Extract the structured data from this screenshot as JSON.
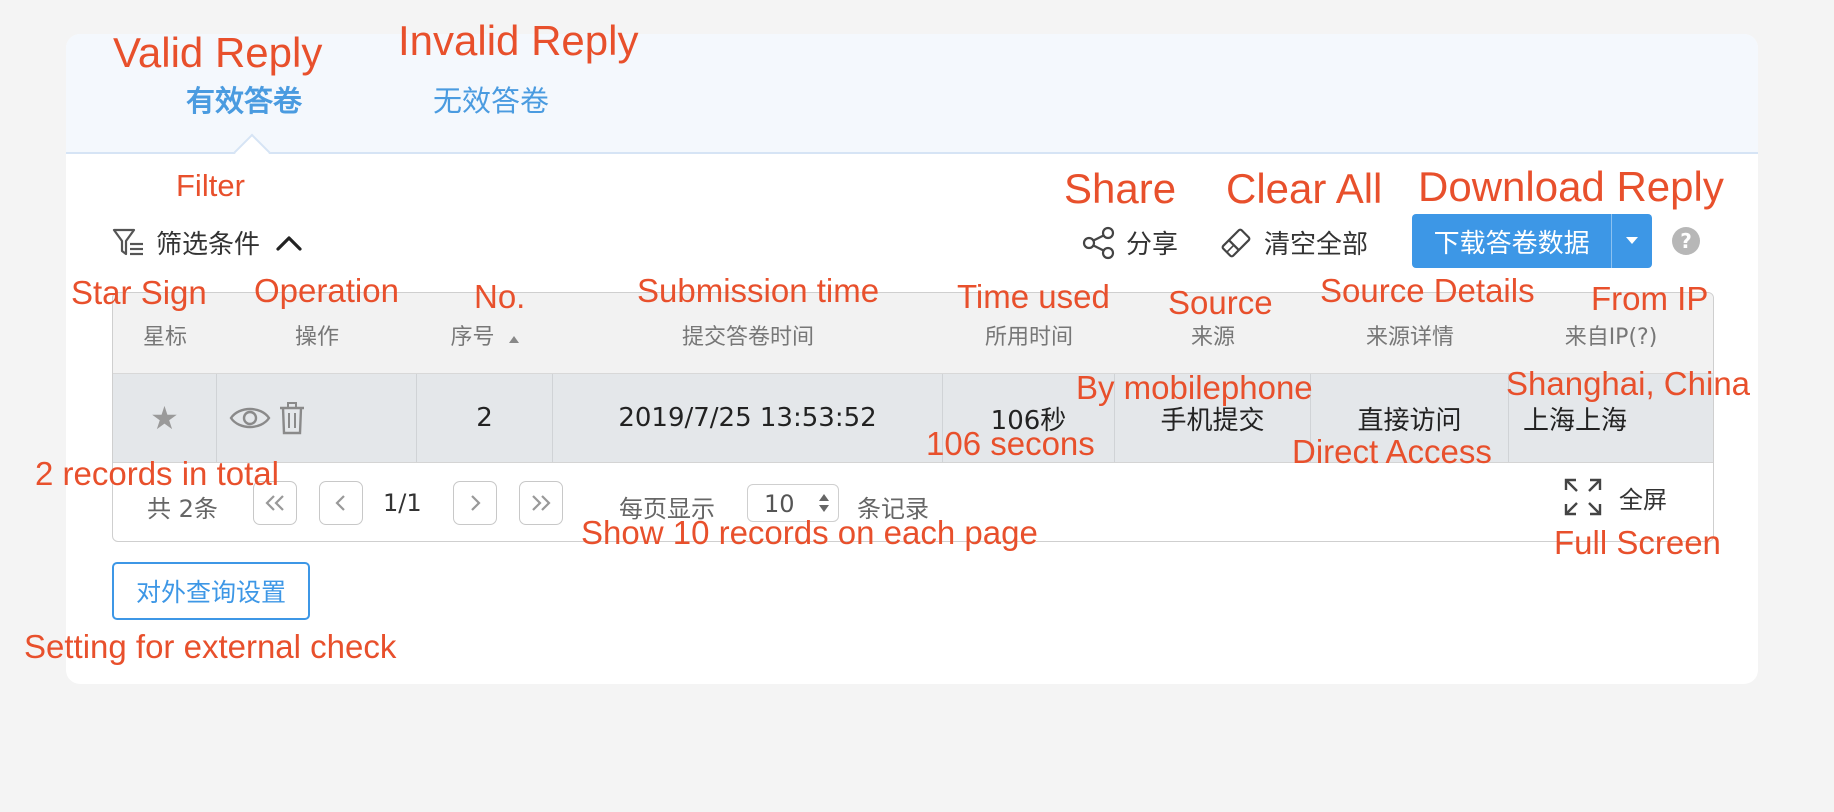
{
  "tabs": [
    {
      "label": "有效答卷",
      "annotation": "Valid Reply",
      "active": true
    },
    {
      "label": "无效答卷",
      "annotation": "Invalid Reply",
      "active": false
    }
  ],
  "filter": {
    "label": "筛选条件",
    "annotation": "Filter"
  },
  "toolbar": {
    "share_label": "分享",
    "share_annotation": "Share",
    "clear_label": "清空全部",
    "clear_annotation": "Clear All",
    "download_label": "下载答卷数据",
    "download_annotation": "Download Reply",
    "help": "?"
  },
  "table": {
    "headers": [
      {
        "label": "星标",
        "annotation": "Star Sign"
      },
      {
        "label": "操作",
        "annotation": "Operation"
      },
      {
        "label": "序号",
        "annotation": "No."
      },
      {
        "label": "提交答卷时间",
        "annotation": "Submission time"
      },
      {
        "label": "所用时间",
        "annotation": "Time used"
      },
      {
        "label": "来源",
        "annotation": "Source"
      },
      {
        "label": "来源详情",
        "annotation": "Source Details"
      },
      {
        "label": "来自IP(?)",
        "annotation": "From IP"
      }
    ],
    "rows": [
      {
        "no": "2",
        "time": "2019/7/25 13:53:52",
        "used": "106秒",
        "used_annotation": "106 secons",
        "source": "手机提交",
        "source_annotation": "By mobilephone",
        "detail": "直接访问",
        "detail_annotation": "Direct Access",
        "ip": "上海上海",
        "ip_annotation": "Shanghai, China"
      }
    ]
  },
  "pager": {
    "total": "共 2条",
    "total_annotation": "2 records in total",
    "page": "1/1",
    "per_page_prefix": "每页显示",
    "per_page": "10",
    "per_page_suffix": "条记录",
    "per_page_annotation": "Show 10 records on each page",
    "fullscreen": "全屏",
    "fullscreen_annotation": "Full Screen"
  },
  "external": {
    "label": "对外查询设置",
    "annotation": "Setting for external check"
  },
  "colors": {
    "accent": "#3d97e6",
    "annotation": "#e8502c"
  }
}
